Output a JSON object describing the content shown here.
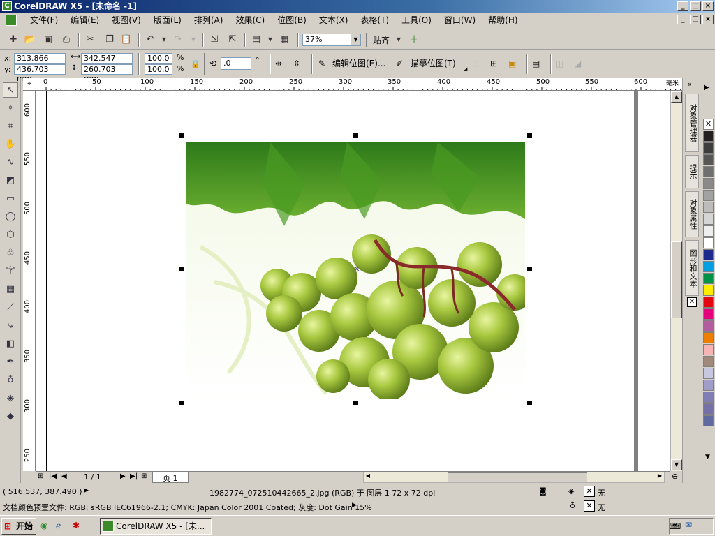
{
  "window": {
    "title": "CorelDRAW X5 - [未命名 -1]",
    "min": "_",
    "max": "□",
    "close": "×"
  },
  "menu": [
    "文件(F)",
    "编辑(E)",
    "视图(V)",
    "版面(L)",
    "排列(A)",
    "效果(C)",
    "位图(B)",
    "文本(X)",
    "表格(T)",
    "工具(O)",
    "窗口(W)",
    "帮助(H)"
  ],
  "toolbar": {
    "zoom": "37%",
    "snap_label": "贴齐"
  },
  "propbar": {
    "x_label": "x:",
    "x_value": "313.866 mm",
    "y_label": "y:",
    "y_value": "436.703 mm",
    "w_value": "342.547 mm",
    "h_value": "260.703 mm",
    "scale_w": "100.0",
    "scale_h": "100.0",
    "pct": "%",
    "rotation": ".0",
    "degree": "°",
    "edit_bitmap": "编辑位图(E)...",
    "trace_bitmap": "描摹位图(T)"
  },
  "ruler": {
    "h_ticks": [
      "0",
      "50",
      "100",
      "150",
      "200",
      "250",
      "300",
      "350",
      "400",
      "450",
      "500",
      "550",
      "600"
    ],
    "v_ticks": [
      "600",
      "550",
      "500",
      "450",
      "400",
      "350",
      "300",
      "250"
    ],
    "unit": "毫米"
  },
  "docker_tabs": [
    "对象管理器",
    "提示",
    "对象属性",
    "图形和文本"
  ],
  "palette": [
    "#ffffff",
    "#231f20",
    "#3d3d3d",
    "#565656",
    "#6f6f6f",
    "#898989",
    "#a2a2a2",
    "#bcbcbc",
    "#d5d5d5",
    "#eeeeee",
    "#ffffff",
    "#1d2b8f",
    "#009fe3",
    "#009245",
    "#ffed00",
    "#e30613",
    "#e5007e",
    "#b25e9e",
    "#ee7d00",
    "#f8b4b4",
    "#a0887a",
    "#c7c7e0",
    "#a09ec8",
    "#7f7eb5",
    "#7570a8",
    "#5f6aa0"
  ],
  "pagenav": {
    "page_count": "1 / 1",
    "page_tab": "页 1"
  },
  "status": {
    "coords": "( 516.537, 387.490 )",
    "object_info": "1982774_072510442665_2.jpg (RGB) 于 图层 1 72 x 72 dpi",
    "color_profile": "文档颜色预置文件: RGB: sRGB IEC61966-2.1; CMYK: Japan Color 2001 Coated; 灰度: Dot Gain 15%",
    "fill_none": "无",
    "outline_none": "无"
  },
  "taskbar": {
    "start": "开始",
    "task": "CorelDRAW X5 - [未..."
  }
}
